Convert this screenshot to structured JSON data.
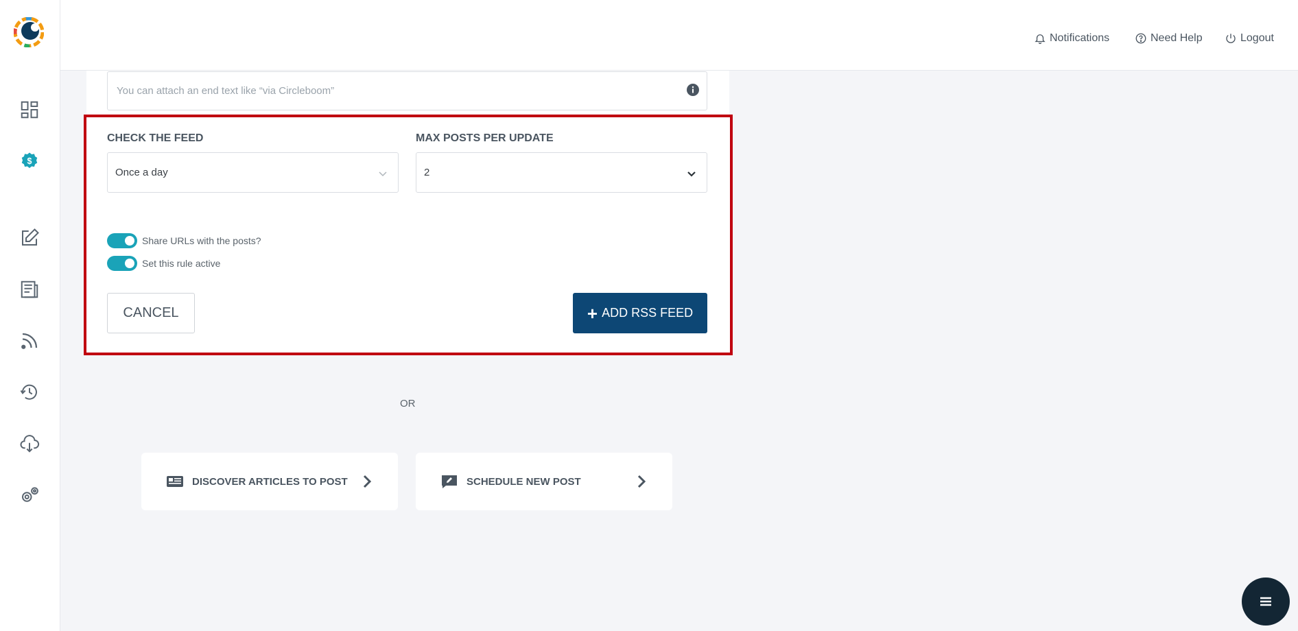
{
  "header": {
    "notifications_label": "Notifications",
    "help_label": "Need Help",
    "logout_label": "Logout"
  },
  "sidebar": {
    "items": [
      "dashboard-icon",
      "dollar-icon",
      "edit-icon",
      "article-icon",
      "rss-icon",
      "history-icon",
      "cloud-download-icon",
      "settings-icon"
    ]
  },
  "form": {
    "end_text_placeholder": "You can attach an end text like “via Circleboom”",
    "check_feed_label": "CHECK THE FEED",
    "check_feed_value": "Once a day",
    "max_posts_label": "MAX POSTS PER UPDATE",
    "max_posts_value": "2",
    "share_urls_label": "Share URLs with the posts?",
    "share_urls_on": true,
    "rule_active_label": "Set this rule active",
    "rule_active_on": true,
    "cancel_label": "CANCEL",
    "add_label": "ADD RSS FEED"
  },
  "or_label": "OR",
  "actions": {
    "discover_label": "DISCOVER ARTICLES TO POST",
    "schedule_label": "SCHEDULE NEW POST"
  },
  "colors": {
    "accent_toggle": "#1aa3b8",
    "primary_button": "#0d4775",
    "highlight_border": "#c00010"
  }
}
